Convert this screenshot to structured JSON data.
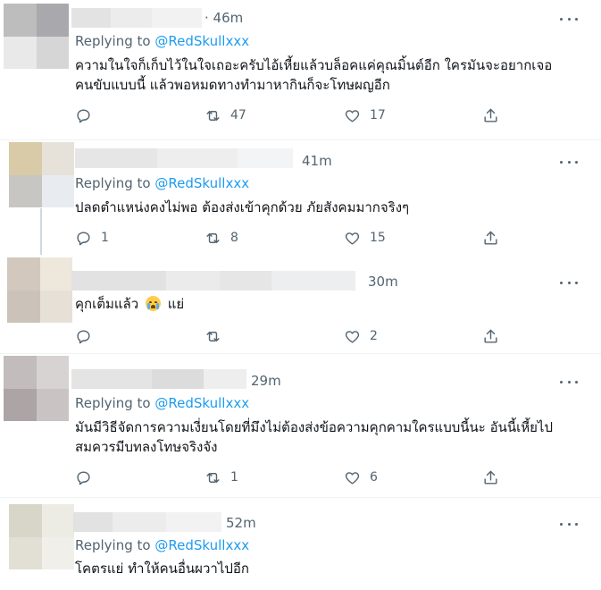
{
  "replying_prefix": "Replying to",
  "tweets": [
    {
      "time": "· 46m",
      "replying_to": "@RedSkullxxx",
      "text_lines": [
        "ความในใจก็เก็บไว้ในใจเถอะครับไอ้เหี้ยแล้วบล็อคแค่คุณมิ้นต์อีก ใครมันจะอยากเจอ",
        "คนขับแบบนี้  แล้วพอหมดทางทำมาหากินก็จะโทษผญอีก"
      ],
      "replies": "",
      "retweets": "47",
      "likes": "17",
      "avatar_colors": [
        "#bdbdbd",
        "#a9a9ad",
        "#e9e9e9",
        "#d6d6d6"
      ]
    },
    {
      "time": "41m",
      "replying_to": "@RedSkullxxx",
      "text_lines": [
        "ปลดตำแหน่งคงไม่พอ ต้องส่งเข้าคุกด้วย ภัยสังคมมากจริงๆ"
      ],
      "replies": "1",
      "retweets": "8",
      "likes": "15",
      "avatar_colors": [
        "#d9cba8",
        "#e6e2da",
        "#c8c6c2",
        "#e8ecf0"
      ]
    },
    {
      "time": "30m",
      "replying_to": "",
      "text_before_emoji": "คุกเต็มแล้ว",
      "text_after_emoji": "แย่",
      "replies": "",
      "retweets": "",
      "likes": "2",
      "avatar_colors": [
        "#d2c8bd",
        "#ede7dc",
        "#cbc3b9",
        "#e6e0d6"
      ]
    },
    {
      "time": "29m",
      "replying_to": "@RedSkullxxx",
      "text_lines": [
        "มันมีวิธีจัดการความเงี่ยนโดยที่มึงไม่ต้องส่งข้อความคุกคามใครแบบนี้นะ อันนี้เหี้ยไป",
        "สมควรมีบทลงโทษจริงจัง"
      ],
      "replies": "",
      "retweets": "1",
      "likes": "6",
      "avatar_colors": [
        "#c2bcbc",
        "#d7d3d3",
        "#ada5a5",
        "#c9c3c3"
      ]
    },
    {
      "time": "52m",
      "replying_to": "@RedSkullxxx",
      "text_lines": [
        "โคตรแย่ ทำให้คนอื่นผวาไปอีก"
      ],
      "avatar_colors": [
        "#d8d5c9",
        "#ecebe4",
        "#e2dfd4",
        "#f0efe9"
      ]
    }
  ],
  "icons": {
    "reply": "reply-icon",
    "retweet": "retweet-icon",
    "like": "heart-icon",
    "share": "share-icon",
    "more": "more-icon"
  }
}
